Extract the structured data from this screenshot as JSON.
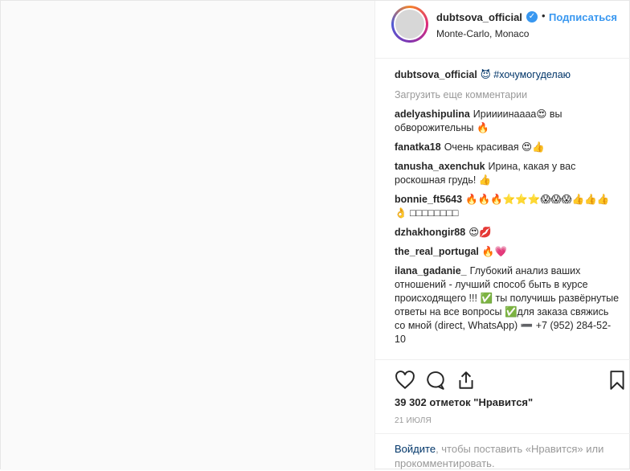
{
  "header": {
    "username": "dubtsova_official",
    "separator": "•",
    "follow_label": "Подписаться",
    "location": "Monte-Carlo, Monaco"
  },
  "caption": {
    "username": "dubtsova_official",
    "text": "😈 #хочумогуделаю"
  },
  "load_more_label": "Загрузить еще комментарии",
  "comments": [
    {
      "user": "adelyashipulina",
      "text": "Ириииинаааа😍 вы обворожительны 🔥"
    },
    {
      "user": "fanatka18",
      "text": "Очень красивая 😍👍"
    },
    {
      "user": "tanusha_axenchuk",
      "text": "Ирина, какая у вас роскошная грудь! 👍"
    },
    {
      "user": "bonnie_ft5643",
      "text": "🔥🔥🔥⭐⭐⭐😱😱😱👍👍👍👌 □□□□□□□□"
    },
    {
      "user": "dzhakhongir88",
      "text": "😍💋"
    },
    {
      "user": "the_real_portugal",
      "text": "🔥💗"
    },
    {
      "user": "ilana_gadanie_",
      "text": "Глубокий анализ ваших отношений - лучший способ быть в курсе происходящего !!! ✅ ты получишь развёрнутые ответы на все вопросы ✅для заказа свяжись со мной (direct, WhatsApp) ➖ +7 (952) 284-52-10"
    }
  ],
  "actions": {
    "like_icon": "heart-icon",
    "comment_icon": "comment-icon",
    "share_icon": "share-icon",
    "save_icon": "bookmark-icon"
  },
  "likes_text": "39 302 отметок \"Нравится\"",
  "date_text": "21 ИЮЛЯ",
  "signin": {
    "link_text": "Войдите",
    "rest_text": ", чтобы поставить «Нравится» или прокомментировать."
  },
  "colors": {
    "link": "#3897f0",
    "muted": "#999999",
    "text": "#262626"
  }
}
